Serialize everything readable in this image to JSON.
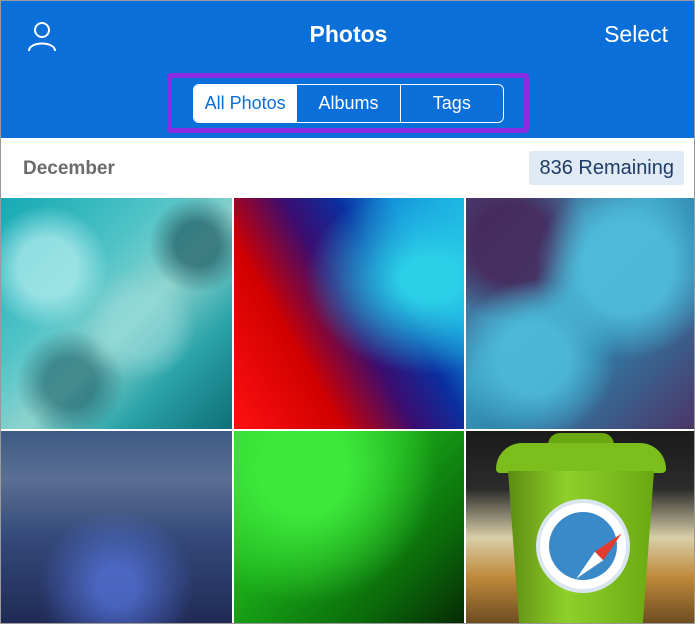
{
  "header": {
    "title": "Photos",
    "select_label": "Select",
    "profile_icon": "person-icon",
    "background_color": "#0a6fd8",
    "highlight_color": "#8a2be2"
  },
  "segmented_control": {
    "selected": "All Photos",
    "segments": [
      {
        "label": "All Photos"
      },
      {
        "label": "Albums"
      },
      {
        "label": "Tags"
      }
    ]
  },
  "section": {
    "month": "December",
    "remaining_label": "836 Remaining"
  },
  "grid": {
    "photos": [
      {
        "description": "teal underwater texture"
      },
      {
        "description": "red and blue gradient glass"
      },
      {
        "description": "purple and cyan paint texture"
      },
      {
        "description": "blue glitter fabric"
      },
      {
        "description": "green noise texture"
      },
      {
        "description": "green trash bin with compass icon"
      }
    ],
    "overlay_icon": "safari-compass-icon"
  }
}
